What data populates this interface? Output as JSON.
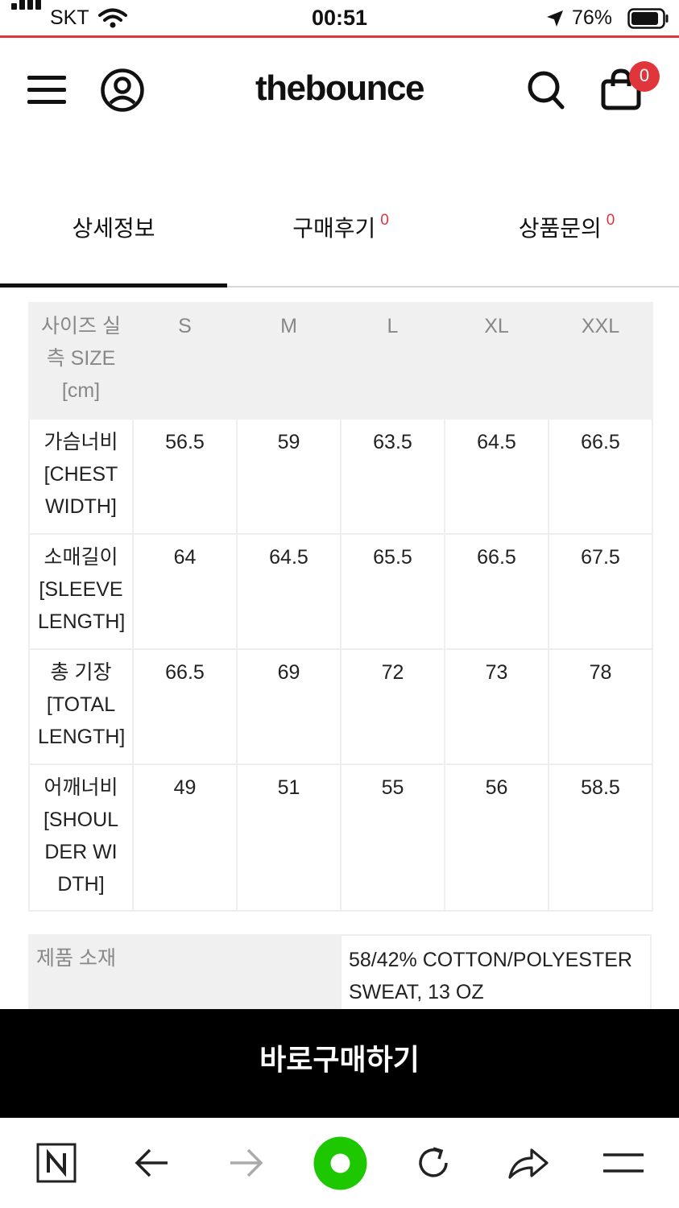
{
  "status_bar": {
    "carrier": "SKT",
    "time": "00:51",
    "battery": "76%"
  },
  "header": {
    "logo": "thebounce",
    "cart_count": "0",
    "icons": [
      "menu-icon",
      "user-icon",
      "search-icon",
      "cart-icon"
    ],
    "accent_color": "#e0363b"
  },
  "tabs": [
    {
      "label": "상세정보",
      "count": "",
      "active": true
    },
    {
      "label": "구매후기",
      "count": "0",
      "active": false
    },
    {
      "label": "상품문의",
      "count": "0",
      "active": false
    }
  ],
  "size_table": {
    "header_label": "사이즈 실측 SIZE [cm]",
    "sizes": [
      "S",
      "M",
      "L",
      "XL",
      "XXL"
    ],
    "rows": [
      {
        "label": "가슴너비 [CHEST WIDTH]",
        "values": [
          "56.5",
          "59",
          "63.5",
          "64.5",
          "66.5"
        ]
      },
      {
        "label": "소매길이 [SLEEVE LENGTH]",
        "values": [
          "64",
          "64.5",
          "65.5",
          "66.5",
          "67.5"
        ]
      },
      {
        "label": "총 기장 [TOTAL LENGTH]",
        "values": [
          "66.5",
          "69",
          "72",
          "73",
          "78"
        ]
      },
      {
        "label": "어깨너비 [SHOULDER WIDTH]",
        "values": [
          "49",
          "51",
          "55",
          "56",
          "58.5"
        ]
      }
    ]
  },
  "material": {
    "label": "제품 소재",
    "value": "58/42% COTTON/POLYESTER SWEAT, 13 OZ"
  },
  "buy_button": "바로구매하기",
  "toolbar": {
    "icons": [
      "naver-icon",
      "back-arrow-icon",
      "forward-arrow-icon",
      "home-circle-icon",
      "refresh-icon",
      "share-icon",
      "more-menu-icon"
    ],
    "home_color": "#1ec800"
  }
}
